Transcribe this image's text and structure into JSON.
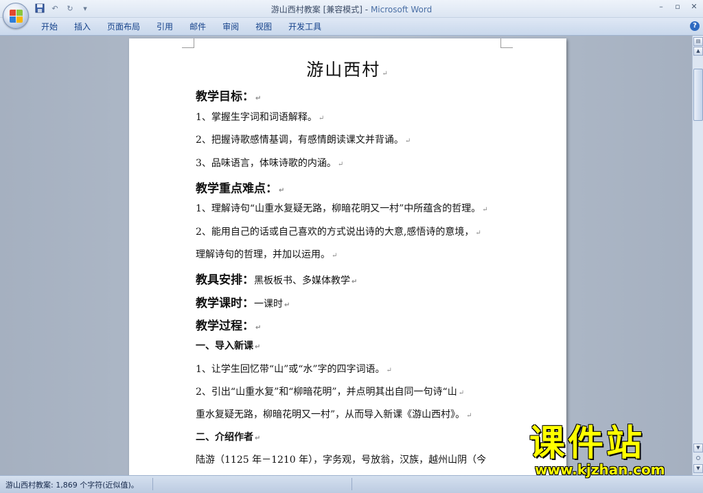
{
  "window": {
    "doc_name": "游山西村教案 [兼容模式]",
    "separator": " - ",
    "app_name": "Microsoft Word",
    "controls": {
      "minimize": "–",
      "restore": "▫",
      "close": "✕"
    }
  },
  "qat": {
    "save_icon": "save-icon",
    "undo": "↶",
    "redo": "↻",
    "more": "▾"
  },
  "ribbon": {
    "tabs": [
      "开始",
      "插入",
      "页面布局",
      "引用",
      "邮件",
      "审阅",
      "视图",
      "开发工具"
    ],
    "help": "?"
  },
  "document": {
    "title": "游山西村",
    "paragraph_mark": "↵",
    "lines": [
      {
        "style": "h",
        "text": "教学目标：",
        "tail": ""
      },
      {
        "style": "p",
        "text": "1、掌握生字词和词语解释。"
      },
      {
        "style": "p",
        "text": "2、把握诗歌感情基调，有感情朗读课文并背诵。"
      },
      {
        "style": "p",
        "text": "3、品味语言，体味诗歌的内涵。"
      },
      {
        "style": "h",
        "text": "教学重点难点：",
        "tail": ""
      },
      {
        "style": "p",
        "text": "1、理解诗句“山重水复疑无路，柳暗花明又一村”中所蕴含的哲理。"
      },
      {
        "style": "p",
        "text": "2、能用自己的话或自己喜欢的方式说出诗的大意,感悟诗的意境，"
      },
      {
        "style": "p",
        "text": "理解诗句的哲理，并加以运用。"
      },
      {
        "style": "h",
        "text": "教具安排：",
        "tail": "黑板板书、多媒体教学"
      },
      {
        "style": "h",
        "text": "教学课时：",
        "tail": "一课时"
      },
      {
        "style": "h",
        "text": "教学过程：",
        "tail": ""
      },
      {
        "style": "sh",
        "text": "一、导入新课"
      },
      {
        "style": "p",
        "text": "1、让学生回忆带“山”或“水”字的四字词语。"
      },
      {
        "style": "p",
        "text": "2、引出“山重水复”和“柳暗花明”，并点明其出自同一句诗“山"
      },
      {
        "style": "p",
        "text": "重水复疑无路，柳暗花明又一村”，从而导入新课《游山西村》。"
      },
      {
        "style": "sh",
        "text": "二、介绍作者"
      },
      {
        "style": "p",
        "text": "陆游（1125 年－1210 年），字务观，号放翁，汉族，越州山阴（今",
        "nomark": true
      }
    ]
  },
  "status": {
    "text": "游山西村教案: 1,869 个字符(近似值)。"
  },
  "watermark": {
    "title": "课件站",
    "url": "www.kjzhan.com"
  }
}
